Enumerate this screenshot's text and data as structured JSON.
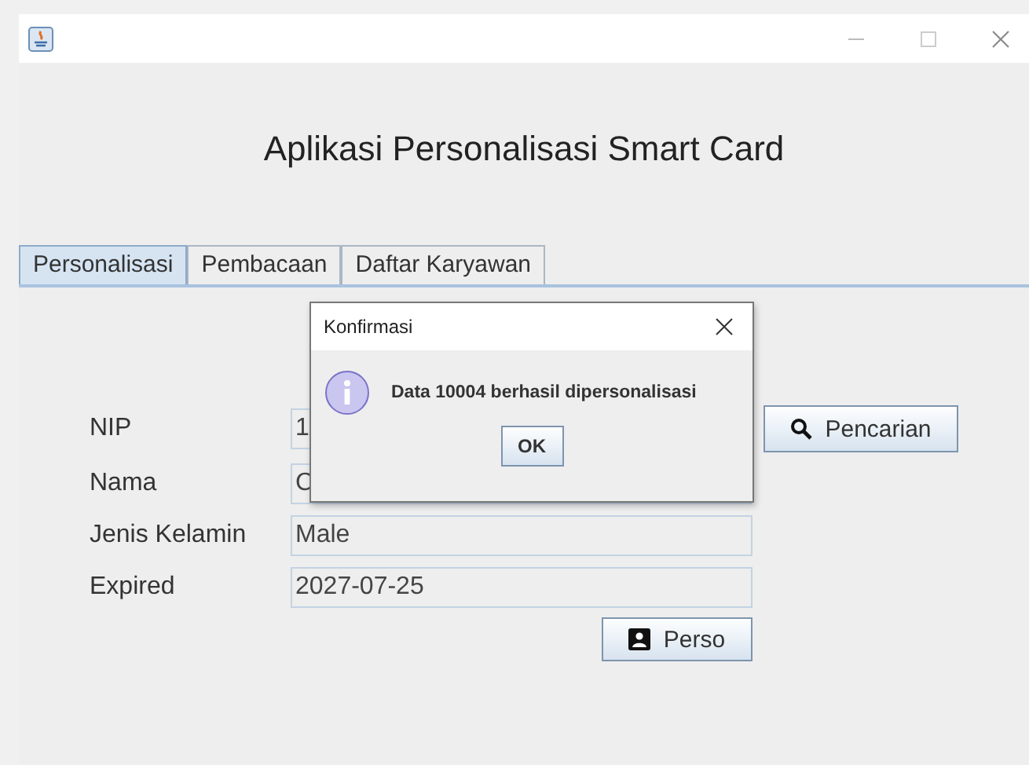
{
  "heading": "Aplikasi Personalisasi Smart Card",
  "tabs": [
    {
      "label": "Personalisasi",
      "selected": true
    },
    {
      "label": "Pembacaan",
      "selected": false
    },
    {
      "label": "Daftar Karyawan",
      "selected": false
    }
  ],
  "form": {
    "fields": [
      {
        "label": "NIP",
        "value": "1"
      },
      {
        "label": "Nama",
        "value": "C"
      },
      {
        "label": "Jenis Kelamin",
        "value": "Male"
      },
      {
        "label": "Expired",
        "value": "2027-07-25"
      }
    ],
    "search_button": "Pencarian",
    "perso_button": "Perso"
  },
  "dialog": {
    "title": "Konfirmasi",
    "message": "Data 10004 berhasil dipersonalisasi",
    "button": "OK"
  }
}
